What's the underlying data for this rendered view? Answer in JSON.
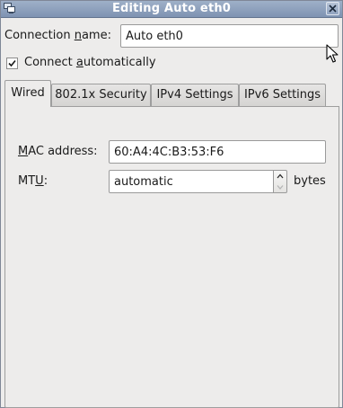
{
  "window": {
    "title": "Editing Auto eth0"
  },
  "connection": {
    "name_label_pre": "Connection ",
    "name_label_u": "n",
    "name_label_post": "ame:",
    "name_value": "Auto eth0"
  },
  "connect_auto": {
    "label_pre": "Connect ",
    "label_u": "a",
    "label_post": "utomatically",
    "checked": true
  },
  "tabs": [
    {
      "label": "Wired",
      "active": true
    },
    {
      "label": "802.1x Security",
      "active": false
    },
    {
      "label": "IPv4 Settings",
      "active": false
    },
    {
      "label": "IPv6 Settings",
      "active": false
    }
  ],
  "wired": {
    "mac_label_u": "M",
    "mac_label_post": "AC address:",
    "mac_value": "60:A4:4C:B3:53:F6",
    "mtu_label_pre": "MT",
    "mtu_label_u": "U",
    "mtu_label_post": ":",
    "mtu_value": "automatic",
    "mtu_unit": "bytes"
  },
  "icons": {
    "app": "network-connection-icon",
    "close": "close-icon",
    "spin_up": "chevron-up-icon",
    "spin_down": "chevron-down-icon",
    "cursor": "mouse-pointer-icon"
  },
  "colors": {
    "titlebar": "#8aa0bd",
    "window_bg": "#edeceb",
    "border": "#9e9e9e"
  }
}
